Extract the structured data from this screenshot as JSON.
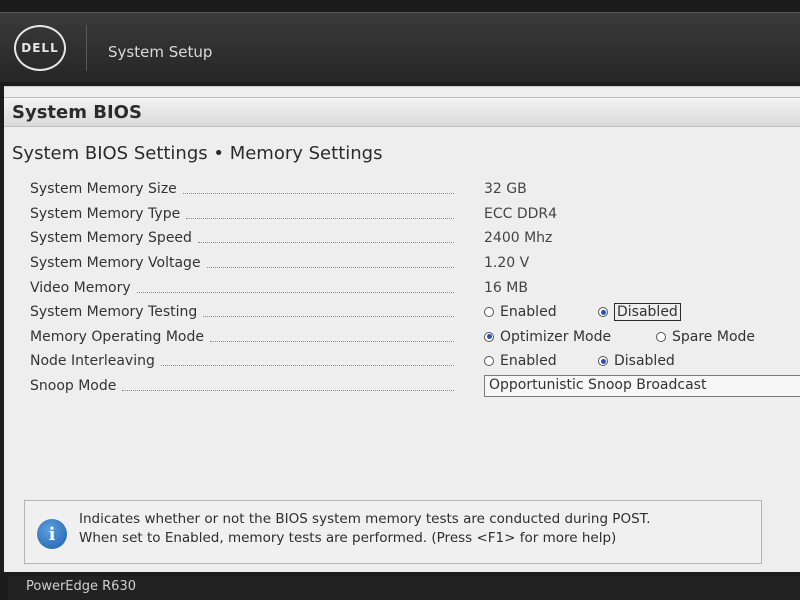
{
  "header": {
    "logo_text": "DELL",
    "app_title": "System Setup"
  },
  "section": {
    "title": "System BIOS",
    "breadcrumb": "System BIOS Settings • Memory Settings"
  },
  "settings": {
    "memory_size": {
      "label": "System Memory Size",
      "value": "32 GB"
    },
    "memory_type": {
      "label": "System Memory Type",
      "value": "ECC DDR4"
    },
    "memory_speed": {
      "label": "System Memory Speed",
      "value": "2400 Mhz"
    },
    "memory_voltage": {
      "label": "System Memory Voltage",
      "value": "1.20 V"
    },
    "video_memory": {
      "label": "Video Memory",
      "value": "16 MB"
    },
    "memory_testing": {
      "label": "System Memory Testing",
      "options": [
        "Enabled",
        "Disabled"
      ],
      "selected": "Disabled"
    },
    "operating_mode": {
      "label": "Memory Operating Mode",
      "options": [
        "Optimizer Mode",
        "Spare Mode"
      ],
      "selected": "Optimizer Mode"
    },
    "node_interleaving": {
      "label": "Node Interleaving",
      "options": [
        "Enabled",
        "Disabled"
      ],
      "selected": "Disabled"
    },
    "snoop_mode": {
      "label": "Snoop Mode",
      "value": "Opportunistic Snoop Broadcast"
    }
  },
  "help": {
    "line1": "Indicates whether or not the BIOS system memory tests are conducted during POST.",
    "line2": "When set to Enabled, memory tests are performed. (Press <F1> for more help)"
  },
  "footer": {
    "model": "PowerEdge R630"
  },
  "colors": {
    "radio_selected": "#2a4fb5",
    "info_icon": "#1f5fa8"
  }
}
